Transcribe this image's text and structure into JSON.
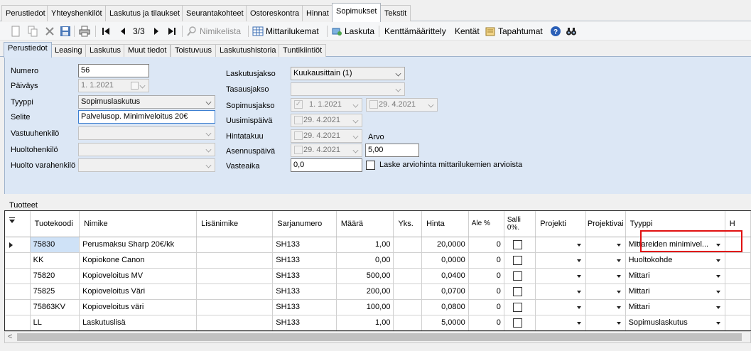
{
  "top_tabs": [
    "Perustiedot",
    "Yhteyshenkilöt",
    "Laskutus ja tilaukset",
    "Seurantakohteet",
    "Ostoreskontra",
    "Hinnat",
    "Sopimukset",
    "Tekstit"
  ],
  "toolbar": {
    "pager": "3/3",
    "nimikelista": "Nimikelista",
    "mittarilukemat": "Mittarilukemat",
    "laskuta": "Laskuta",
    "kenttamaarittely": "Kenttämäärittely",
    "kentat": "Kentät",
    "tapahtumat": "Tapahtumat"
  },
  "sub_tabs": [
    "Perustiedot",
    "Leasing",
    "Laskutus",
    "Muut tiedot",
    "Toistuvuus",
    "Laskutushistoria",
    "Tuntikiintiöt"
  ],
  "form": {
    "numero_label": "Numero",
    "numero_value": "56",
    "paivays_label": "Päiväys",
    "paivays_value": "1. 1.2021",
    "tyyppi_label": "Tyyppi",
    "tyyppi_value": "Sopimuslaskutus",
    "selite_label": "Selite",
    "selite_value": "Palvelusop. Minimiveloitus 20€",
    "vastuuhenkilo_label": "Vastuuhenkilö",
    "huoltohenkilo_label": "Huoltohenkilö",
    "huolto_varahenkilo_label": "Huolto varahenkilö",
    "laskutusjakso_label": "Laskutusjakso",
    "laskutusjakso_value": "Kuukausittain (1)",
    "tasausjakso_label": "Tasausjakso",
    "sopimusjakso_label": "Sopimusjakso",
    "sopimusjakso_start": "1. 1.2021",
    "sopimusjakso_end": "29. 4.2021",
    "uusimispaiva_label": "Uusimispäivä",
    "uusimispaiva_value": "29. 4.2021",
    "hintatakuu_label": "Hintatakuu",
    "hintatakuu_value": "29. 4.2021",
    "arvo_label": "Arvo",
    "asennuspaiva_label": "Asennuspäivä",
    "asennuspaiva_value": "29. 4.2021",
    "arvo_value": "5,00",
    "vasteaika_label": "Vasteaika",
    "vasteaika_value": "0,0",
    "laske_label": "Laske arviohinta mittarilukemien arvioista"
  },
  "tuotteet": {
    "title": "Tuotteet",
    "columns": [
      "Tuotekoodi",
      "Nimike",
      "Lisänimike",
      "Sarjanumero",
      "Määrä",
      "Yks.",
      "Hinta",
      "Ale %",
      "Salli 0%.",
      "Projekti",
      "Projektivai",
      "Tyyppi",
      "H"
    ],
    "rows": [
      {
        "code": "75830",
        "name": "Perusmaksu Sharp 20€/kk",
        "extra": "",
        "serial": "SH133",
        "qty": "1,00",
        "unit": "",
        "price": "20,0000",
        "ale": "0",
        "type": "Mittareiden minimivel..."
      },
      {
        "code": "KK",
        "name": "Kopiokone Canon",
        "extra": "",
        "serial": "SH133",
        "qty": "0,00",
        "unit": "",
        "price": "0,0000",
        "ale": "0",
        "type": "Huoltokohde"
      },
      {
        "code": "75820",
        "name": "Kopioveloitus MV",
        "extra": "",
        "serial": "SH133",
        "qty": "500,00",
        "unit": "",
        "price": "0,0400",
        "ale": "0",
        "type": "Mittari"
      },
      {
        "code": "75825",
        "name": "Kopioveloitus Väri",
        "extra": "",
        "serial": "SH133",
        "qty": "200,00",
        "unit": "",
        "price": "0,0700",
        "ale": "0",
        "type": "Mittari"
      },
      {
        "code": "75863KV",
        "name": "Kopioveloitus väri",
        "extra": "",
        "serial": "SH133",
        "qty": "100,00",
        "unit": "",
        "price": "0,0800",
        "ale": "0",
        "type": "Mittari"
      },
      {
        "code": "LL",
        "name": "Laskutuslisä",
        "extra": "",
        "serial": "SH133",
        "qty": "1,00",
        "unit": "",
        "price": "5,0000",
        "ale": "0",
        "type": "Sopimuslaskutus"
      }
    ]
  },
  "colors": {
    "panel": "#dce7f5",
    "selected_cell": "#cfe2f7",
    "highlight": "#e01010"
  }
}
